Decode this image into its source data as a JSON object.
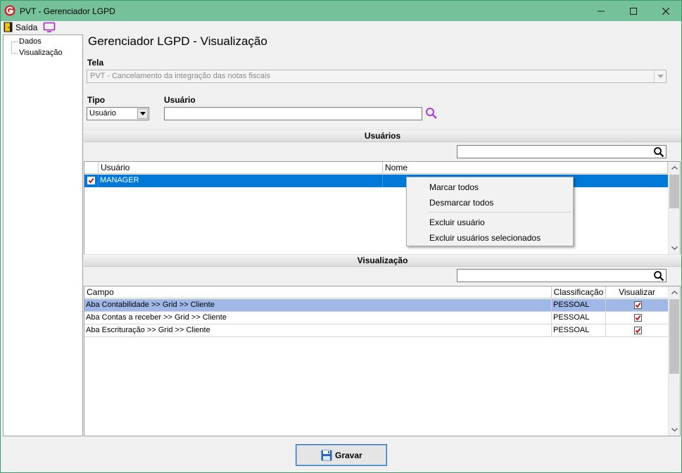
{
  "window": {
    "title": "PVT - Gerenciador LGPD"
  },
  "menu": {
    "exit_label": "Saída"
  },
  "tree": {
    "items": [
      {
        "label": "Dados"
      },
      {
        "label": "Visualização"
      }
    ]
  },
  "page": {
    "title": "Gerenciador LGPD - Visualização"
  },
  "tela": {
    "label": "Tela",
    "value": "PVT - Cancelamento da integração das notas fiscais"
  },
  "tipo": {
    "label": "Tipo",
    "value": "Usuário"
  },
  "usuario_field": {
    "label": "Usuário",
    "value": ""
  },
  "usuarios_section": {
    "title": "Usuários",
    "filter_value": "",
    "columns": [
      "Usuário",
      "Nome"
    ],
    "rows": [
      {
        "checked": true,
        "usuario": "MANAGER",
        "nome": "",
        "selected": true
      }
    ]
  },
  "context_menu": {
    "items": [
      {
        "label": "Marcar todos"
      },
      {
        "label": "Desmarcar todos"
      },
      {
        "label": "Excluir usuário"
      },
      {
        "label": "Excluir usuários selecionados"
      }
    ]
  },
  "visualizacao_section": {
    "title": "Visualização",
    "filter_value": "",
    "columns": [
      "Campo",
      "Classificação",
      "Visualizar"
    ],
    "rows": [
      {
        "campo": "Aba Contabilidade >> Grid >> Cliente",
        "classificacao": "PESSOAL",
        "visualizar": true,
        "selected": true
      },
      {
        "campo": "Aba Contas a receber >> Grid >> Cliente",
        "classificacao": "PESSOAL",
        "visualizar": true,
        "selected": false
      },
      {
        "campo": "Aba Escrituração >> Grid >> Cliente",
        "classificacao": "PESSOAL",
        "visualizar": true,
        "selected": false
      }
    ]
  },
  "footer": {
    "save_label": "Gravar"
  },
  "colors": {
    "titlebar": "#75c29a",
    "selection": "#0078d7",
    "row_highlight": "#9fb8e8",
    "checkbox_mark": "#d40000",
    "search_accent": "#a83dd6"
  }
}
